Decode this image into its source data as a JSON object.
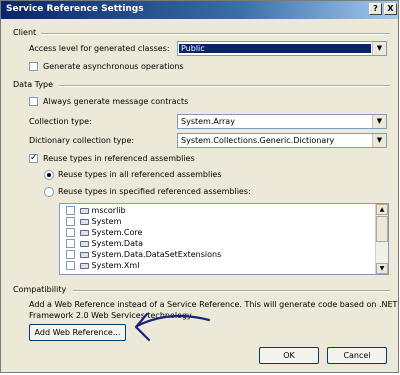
{
  "window": {
    "title": "Service Reference Settings",
    "help_button": "?",
    "close_button": "X"
  },
  "client": {
    "section_label": "Client",
    "access_level_label": "Access level for generated classes:",
    "access_level_value": "Public",
    "async_label": "Generate asynchronous operations",
    "async_checked": false
  },
  "data_type": {
    "section_label": "Data Type",
    "message_contracts_label": "Always generate message contracts",
    "message_contracts_checked": false,
    "collection_type_label": "Collection type:",
    "collection_type_value": "System.Array",
    "dictionary_type_label": "Dictionary collection type:",
    "dictionary_type_value": "System.Collections.Generic.Dictionary",
    "reuse_types_label": "Reuse types in referenced assemblies",
    "reuse_types_checked": true,
    "reuse_all_label": "Reuse types in all referenced assemblies",
    "reuse_all_selected": true,
    "reuse_specified_label": "Reuse types in specified referenced assemblies:",
    "reuse_specified_selected": false,
    "assemblies": [
      "mscorlib",
      "System",
      "System.Core",
      "System.Data",
      "System.Data.DataSetExtensions",
      "System.Xml"
    ]
  },
  "compatibility": {
    "section_label": "Compatibility",
    "description_line1": "Add a Web Reference instead of a Service Reference. This will generate code based on .NET",
    "description_line2": "Framework 2.0 Web Services technology.",
    "add_web_reference_label": "Add Web Reference..."
  },
  "footer": {
    "ok_label": "OK",
    "cancel_label": "Cancel"
  },
  "colors": {
    "title_bar": "#0a246a",
    "annotation_arrow": "#1a237e"
  }
}
